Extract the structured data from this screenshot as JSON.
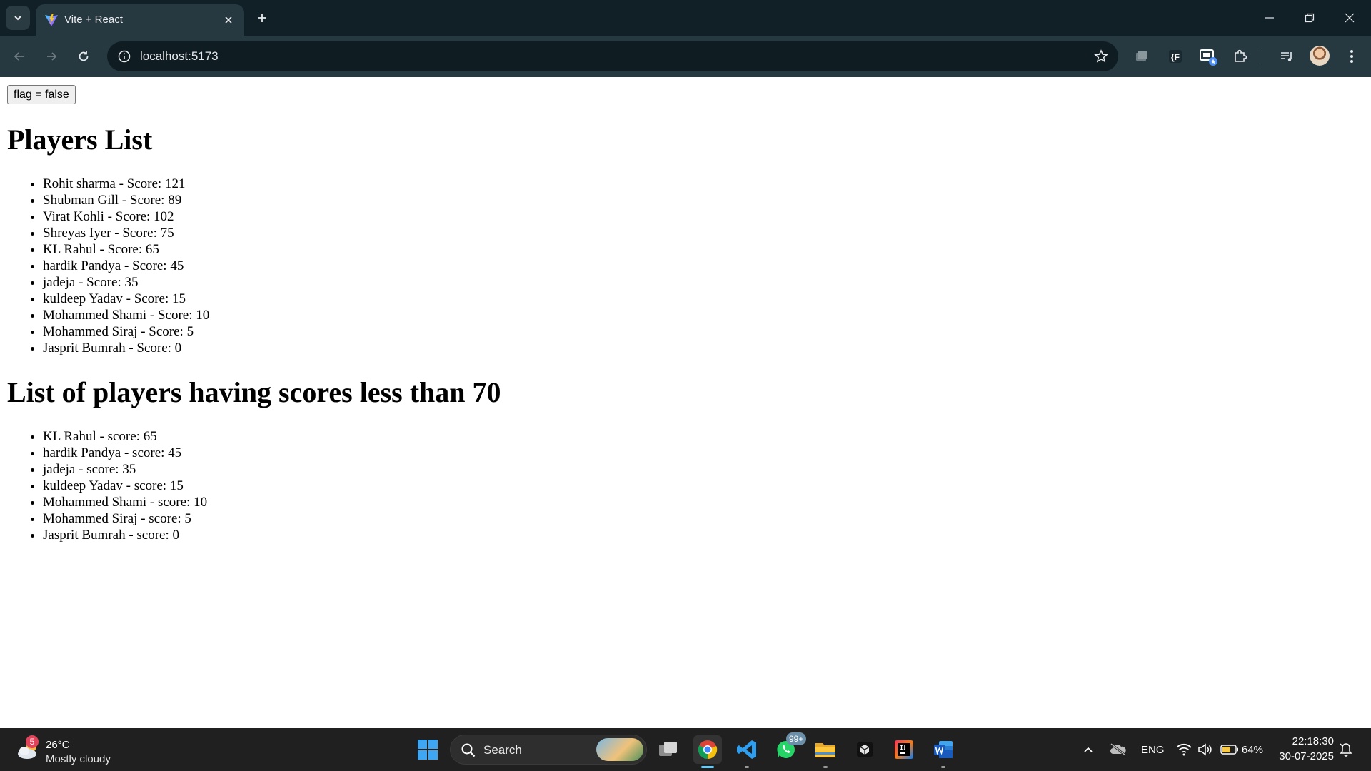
{
  "browser": {
    "tab": {
      "title": "Vite + React"
    },
    "address": {
      "url": "localhost:5173"
    }
  },
  "page": {
    "flag_button_label": "flag = false",
    "players_heading": "Players List",
    "players": [
      "Rohit sharma - Score: 121",
      "Shubman Gill - Score: 89",
      "Virat Kohli - Score: 102",
      "Shreyas Iyer - Score: 75",
      "KL Rahul - Score: 65",
      "hardik Pandya - Score: 45",
      "jadeja - Score: 35",
      "kuldeep Yadav - Score: 15",
      "Mohammed Shami - Score: 10",
      "Mohammed Siraj - Score: 5",
      "Jasprit Bumrah - Score: 0"
    ],
    "filtered_heading": "List of players having scores less than 70",
    "filtered_players": [
      "KL Rahul - score: 65",
      "hardik Pandya - score: 45",
      "jadeja - score: 35",
      "kuldeep Yadav - score: 15",
      "Mohammed Shami - score: 10",
      "Mohammed Siraj - score: 5",
      "Jasprit Bumrah - score: 0"
    ]
  },
  "taskbar": {
    "weather": {
      "temp": "26°C",
      "condition": "Mostly cloudy",
      "badge": "5"
    },
    "search_label": "Search",
    "whatsapp_badge": "99+",
    "language": "ENG",
    "battery": "64%",
    "time": "22:18:30",
    "date": "30-07-2025"
  },
  "colors": {
    "tabstrip_bg": "#112027",
    "toolbar_bg": "#263840",
    "taskbar_bg": "#202020",
    "accent": "#60cdff"
  }
}
